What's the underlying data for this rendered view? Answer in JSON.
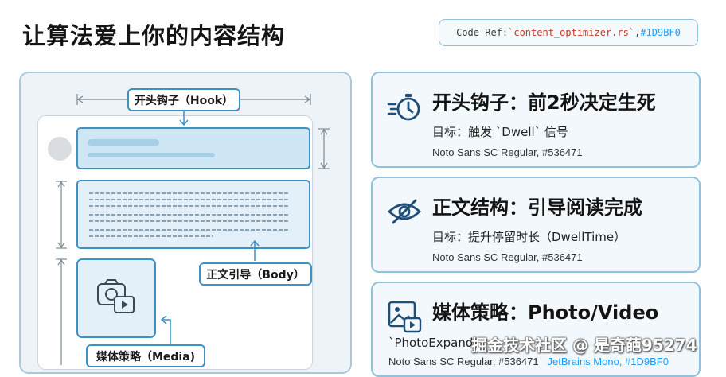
{
  "title": "让算法爱上你的内容结构",
  "code_ref": {
    "prefix": "Code Ref: ",
    "file": "`content_optimizer.rs`",
    "sep": ", ",
    "color_code": "#1D9BF0"
  },
  "diagram": {
    "hook_label": "开头钩子（Hook）",
    "body_label": "正文引导（Body）",
    "media_label": "媒体策略（Media)"
  },
  "cards": [
    {
      "icon": "stopwatch-icon",
      "heading": "开头钩子：前2秒决定生死",
      "goal": "目标：触发 `Dwell` 信号",
      "font_note": "Noto Sans SC Regular, #536471"
    },
    {
      "icon": "eye-slash-icon",
      "heading": "正文结构：引导阅读完成",
      "goal": "目标：提升停留时长（DwellTime）",
      "font_note": "Noto Sans SC Regular, #536471"
    },
    {
      "icon": "photo-video-icon",
      "heading": "媒体策略：Photo/Video",
      "goal": "`PhotoExpand",
      "font_note": "Noto Sans SC Regular, #536471",
      "mono_note": "JetBrains Mono, #1D9BF0"
    }
  ],
  "watermark": "掘金技术社区 @ 是奇葩95274",
  "colors": {
    "accent": "#3C92C4",
    "card_border": "#8FC3DC",
    "mono": "#1D9BF0"
  }
}
